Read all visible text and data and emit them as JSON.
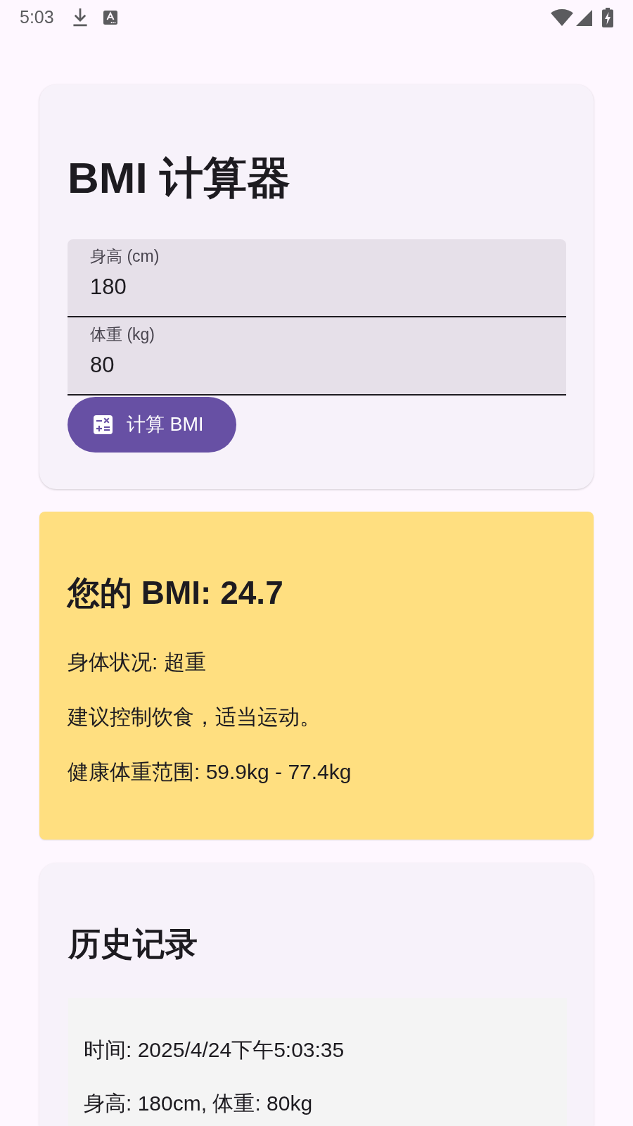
{
  "status_bar": {
    "time": "5:03"
  },
  "calculator": {
    "title": "BMI 计算器",
    "fields": [
      {
        "label": "身高 (cm)",
        "value": "180"
      },
      {
        "label": "体重 (kg)",
        "value": "80"
      }
    ],
    "button": {
      "label": "计算 BMI"
    }
  },
  "result": {
    "heading": "您的 BMI: 24.7",
    "lines": [
      "身体状况: 超重",
      "建议控制饮食，适当运动。",
      "健康体重范围: 59.9kg - 77.4kg"
    ]
  },
  "history": {
    "title": "历史记录",
    "entries": [
      {
        "lines": [
          "时间: 2025/4/24下午5:03:35",
          "身高: 180cm, 体重: 80kg"
        ]
      }
    ]
  }
}
